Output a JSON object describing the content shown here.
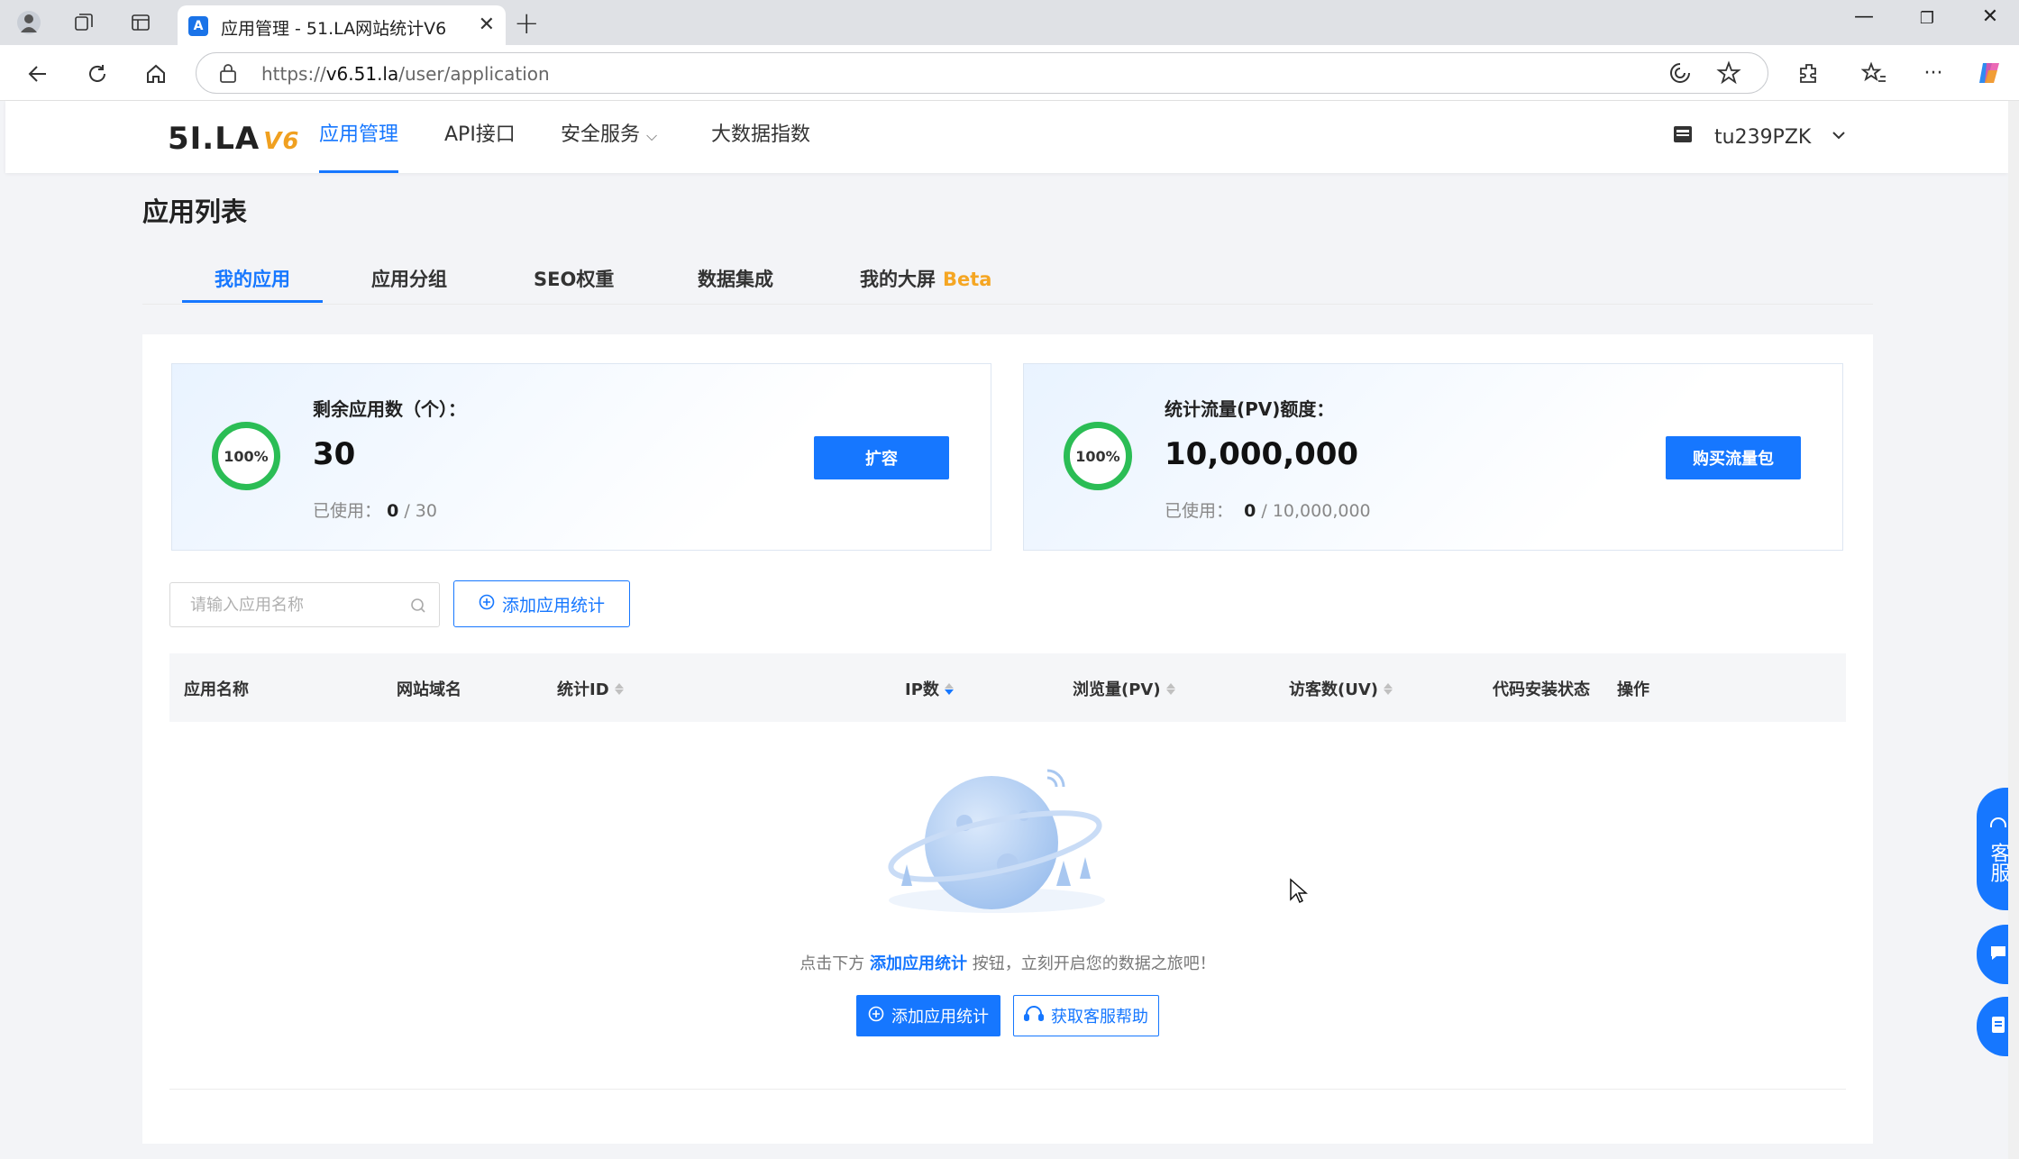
{
  "browser": {
    "tab_title": "应用管理 - 51.LA网站统计V6",
    "url_prefix": "https://",
    "url_host": "v6.51.la",
    "url_path": "/user/application"
  },
  "header": {
    "logo_text": "5I.LA",
    "logo_version": "V6",
    "nav": [
      "应用管理",
      "API接口",
      "安全服务",
      "大数据指数"
    ],
    "username": "tu239PZK"
  },
  "page": {
    "title": "应用列表",
    "subtabs": [
      "我的应用",
      "应用分组",
      "SEO权重",
      "数据集成",
      "我的大屏"
    ],
    "beta_label": "Beta"
  },
  "cards": [
    {
      "percent": "100%",
      "label": "剩余应用数（个）：",
      "value": "30",
      "used_label": "已使用：",
      "used": "0",
      "total": "/ 30",
      "button": "扩容"
    },
    {
      "percent": "100%",
      "label": "统计流量(PV)额度：",
      "value": "10,000,000",
      "used_label": "已使用：",
      "used": "0",
      "total": "/ 10,000,000",
      "button": "购买流量包"
    }
  ],
  "toolbar": {
    "search_placeholder": "请输入应用名称",
    "add_label": "添加应用统计"
  },
  "table": {
    "columns": [
      "应用名称",
      "网站域名",
      "统计ID",
      "IP数",
      "浏览量(PV)",
      "访客数(UV)",
      "代码安装状态",
      "操作"
    ],
    "rows": []
  },
  "empty": {
    "prefix": "点击下方",
    "link": "添加应用统计",
    "suffix": "按钮，立刻开启您的数据之旅吧！",
    "primary_btn": "添加应用统计",
    "help_btn": "获取客服帮助"
  },
  "float": {
    "cs_label": "客服"
  },
  "colors": {
    "primary": "#1677ff",
    "ring": "#2bbd55",
    "beta": "#f5a623"
  }
}
